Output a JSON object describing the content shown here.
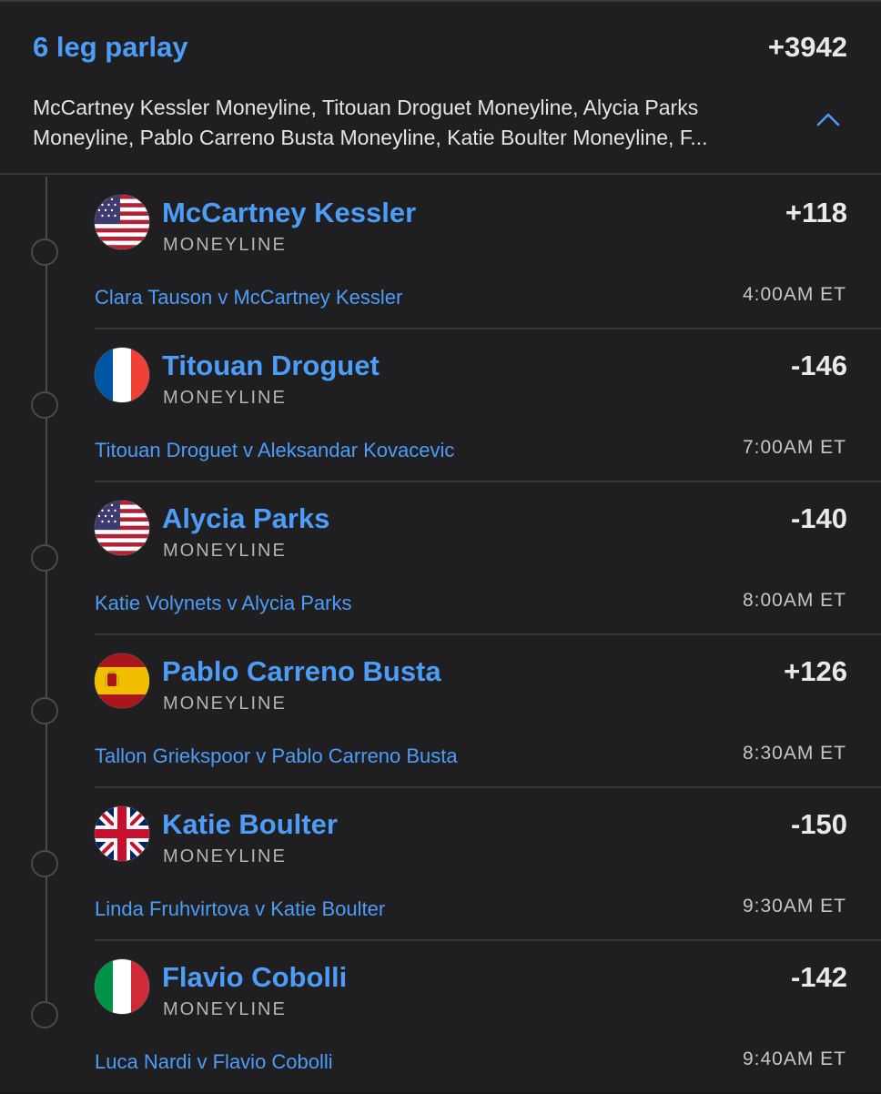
{
  "parlay": {
    "title": "6 leg parlay",
    "odds": "+3942",
    "summary": "McCartney Kessler Moneyline, Titouan Droguet Moneyline, Alycia Parks Moneyline, Pablo Carreno Busta Moneyline, Katie Boulter Moneyline, F...",
    "collapse_icon": "chevron-up-icon"
  },
  "legs": [
    {
      "player": "McCartney Kessler",
      "market": "MONEYLINE",
      "odds": "+118",
      "matchup": "Clara Tauson v McCartney Kessler",
      "time": "4:00AM ET",
      "flag": "usa-flag-icon"
    },
    {
      "player": "Titouan Droguet",
      "market": "MONEYLINE",
      "odds": "-146",
      "matchup": "Titouan Droguet v Aleksandar Kovacevic",
      "time": "7:00AM ET",
      "flag": "france-flag-icon"
    },
    {
      "player": "Alycia Parks",
      "market": "MONEYLINE",
      "odds": "-140",
      "matchup": "Katie Volynets v Alycia Parks",
      "time": "8:00AM ET",
      "flag": "usa-flag-icon"
    },
    {
      "player": "Pablo Carreno Busta",
      "market": "MONEYLINE",
      "odds": "+126",
      "matchup": "Tallon Griekspoor v Pablo Carreno Busta",
      "time": "8:30AM ET",
      "flag": "spain-flag-icon"
    },
    {
      "player": "Katie Boulter",
      "market": "MONEYLINE",
      "odds": "-150",
      "matchup": "Linda Fruhvirtova v Katie Boulter",
      "time": "9:30AM ET",
      "flag": "uk-flag-icon"
    },
    {
      "player": "Flavio Cobolli",
      "market": "MONEYLINE",
      "odds": "-142",
      "matchup": "Luca Nardi v Flavio Cobolli",
      "time": "9:40AM ET",
      "flag": "italy-flag-icon"
    }
  ],
  "colors": {
    "accent": "#4d9cf6",
    "background": "#1f1f21",
    "divider": "#38383b"
  }
}
